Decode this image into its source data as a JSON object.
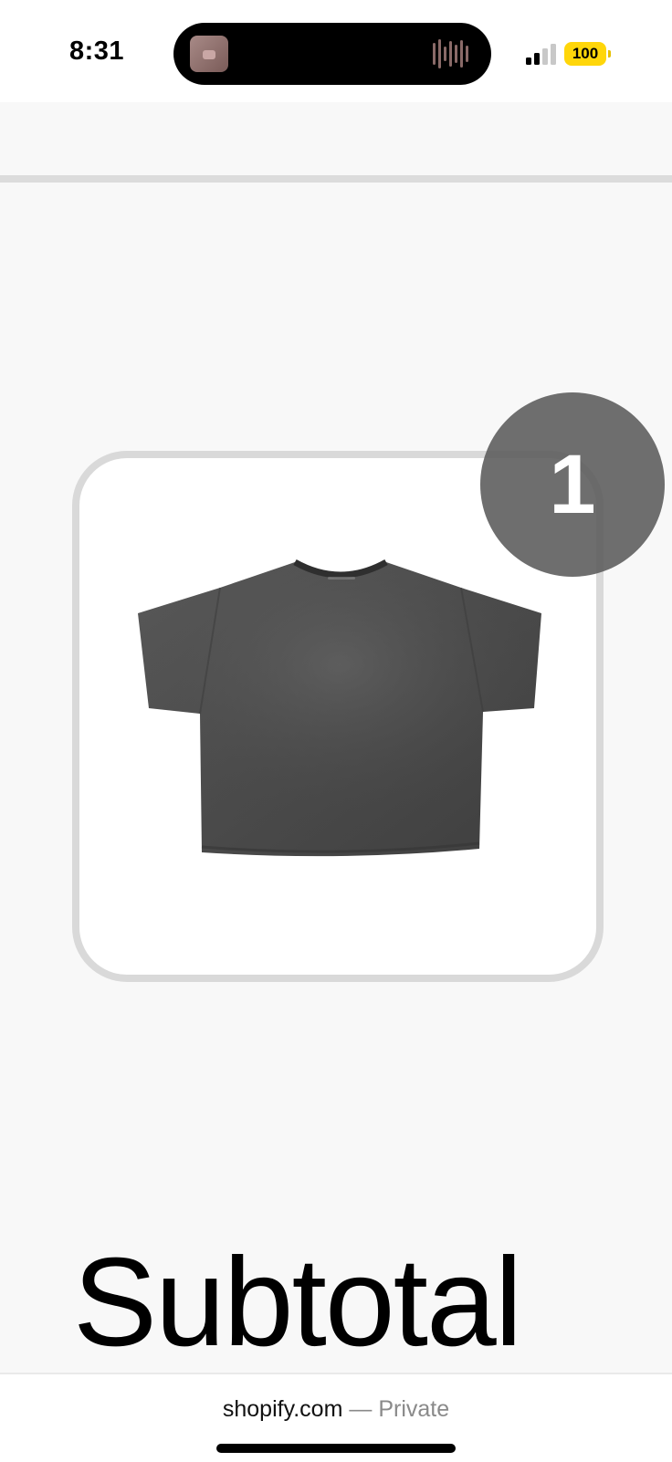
{
  "status_bar": {
    "time": "8:31",
    "battery_level": "100",
    "battery_color": "#ffd60a",
    "icons": [
      "music-thumbnail-icon",
      "audio-waveform-icon",
      "signal-icon",
      "battery-icon"
    ]
  },
  "cart": {
    "item_quantity": "1",
    "item_image_icon": "gray-tshirt-image",
    "subtotal_label": "Subtotal"
  },
  "browser": {
    "domain": "shopify.com",
    "separator": " — ",
    "mode": "Private"
  }
}
